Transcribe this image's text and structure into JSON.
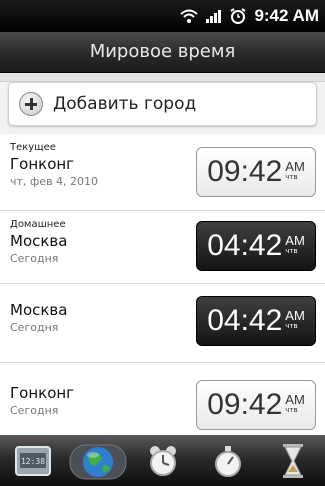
{
  "status": {
    "time": "9:42 AM",
    "icons": [
      "wifi-icon",
      "signal-icon",
      "alarm-icon"
    ]
  },
  "header": {
    "title": "Мировое время"
  },
  "add_city": {
    "label": "Добавить город",
    "icon": "plus-icon"
  },
  "cities": [
    {
      "category": "Текущее",
      "city": "Гонконг",
      "sub": "чт, фев 4, 2010",
      "time": "09:42",
      "ampm": "AM",
      "day": "чтв",
      "theme": "light"
    },
    {
      "category": "Домашнее",
      "city": "Москва",
      "sub": "Сегодня",
      "time": "04:42",
      "ampm": "AM",
      "day": "чтв",
      "theme": "dark"
    },
    {
      "category": "",
      "city": "Москва",
      "sub": "Сегодня",
      "time": "04:42",
      "ampm": "AM",
      "day": "чтв",
      "theme": "dark"
    },
    {
      "category": "",
      "city": "Гонконг",
      "sub": "Сегодня",
      "time": "09:42",
      "ampm": "AM",
      "day": "чтв",
      "theme": "light"
    }
  ],
  "tabs": [
    {
      "name": "clock-tab",
      "icon": "digital-clock-icon",
      "text": "12:38",
      "active": false
    },
    {
      "name": "world-clock-tab",
      "icon": "globe-icon",
      "active": true
    },
    {
      "name": "alarm-tab",
      "icon": "alarm-clock-icon",
      "active": false
    },
    {
      "name": "stopwatch-tab",
      "icon": "stopwatch-icon",
      "active": false
    },
    {
      "name": "timer-tab",
      "icon": "hourglass-icon",
      "active": false
    }
  ],
  "colors": {
    "title_bar": "#2a2a2a",
    "dark_clock": "#1a1a1a",
    "light_clock": "#f5f5f5",
    "globe": "#2f7fd1"
  }
}
